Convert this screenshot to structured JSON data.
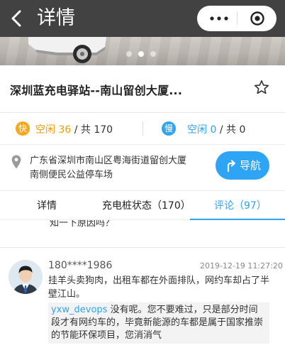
{
  "header": {
    "title": "详情",
    "back_icon": "chevron-left-icon",
    "more_icon": "more-dots-icon",
    "close_icon": "target-circle-icon"
  },
  "banner": {
    "page_count": 3,
    "active_page": 2
  },
  "station": {
    "name": "深圳蓝充电驿站--南山留创大厦..."
  },
  "counts": {
    "fast_badge": "快",
    "fast_free_label": "空闲",
    "fast_free": "36",
    "fast_total": "/ 共 170",
    "slow_badge": "慢",
    "slow_free_label": "空闲",
    "slow_free": "0",
    "slow_total": "/ 共 0"
  },
  "address": {
    "text": "广东省深圳市南山区粤海街道留创大厦南侧便民公益停车场",
    "nav_label": "导航"
  },
  "tabs": [
    {
      "label": "详情"
    },
    {
      "label": "充电桩状态（170）"
    },
    {
      "label": "评论（97）",
      "active": true
    }
  ],
  "comments": {
    "previous_clip": "知一下原因吗？",
    "items": [
      {
        "user": "180****1986",
        "time": "2019-12-19 11:27:20",
        "body": "挂羊头卖狗肉，出租车都在外面排队，网约车却占了半壁江山。",
        "reply_user": "yxw_devops",
        "reply_text": "没有呢。您不要难过，只是部分时间段才有网约车的，毕竟新能源的车都是属于国家推崇的节能环保项目，您消消气"
      }
    ]
  },
  "colors": {
    "accent": "#2ea4f4",
    "fast": "#f7a91a",
    "topbar": "#424242"
  }
}
